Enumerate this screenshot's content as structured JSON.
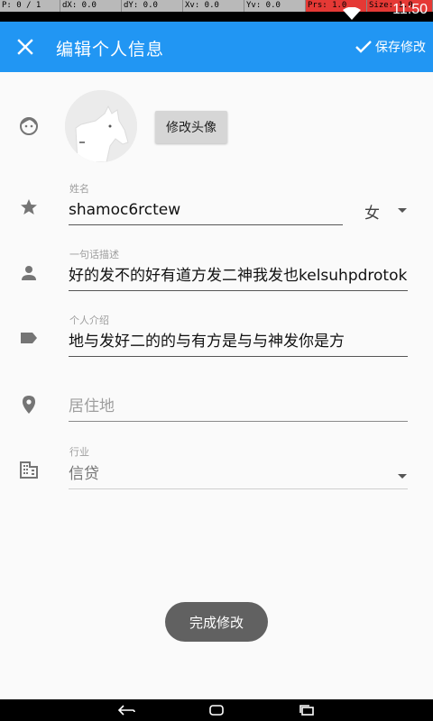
{
  "status_bar": {
    "debug": {
      "p": "P: 0 / 1",
      "dx": "dX: 0.0",
      "dy": "dY: 0.0",
      "xv": "Xv: 0.0",
      "yv": "Yv: 0.0",
      "prs": "Prs: 1.0",
      "size": "Size: 1.0"
    },
    "time": "11:50"
  },
  "toolbar": {
    "title": "编辑个人信息",
    "save_label": "保存修改",
    "close_icon": "close-icon",
    "save_icon": "check-icon",
    "background": "#2196f3"
  },
  "avatar_row": {
    "icon": "face-icon",
    "change_avatar_label": "修改头像"
  },
  "name_row": {
    "icon": "star-icon",
    "label": "姓名",
    "value": "shamoc6rctew",
    "gender": "女"
  },
  "tagline_row": {
    "icon": "person-icon",
    "label": "一句话描述",
    "value": "好的发不的好有道方发二神我发也kelsuhpdrotok"
  },
  "intro_row": {
    "icon": "label-icon",
    "label": "个人介绍",
    "value": "地与发好二的的与有方是与与神发你是方"
  },
  "location_row": {
    "icon": "location-pin-icon",
    "placeholder": "居住地"
  },
  "industry_row": {
    "icon": "business-icon",
    "label": "行业",
    "value": "信贷"
  },
  "done_button": {
    "label": "完成修改"
  },
  "nav_bar": {
    "back": "back-icon",
    "home": "home-icon",
    "recents": "recents-icon"
  }
}
